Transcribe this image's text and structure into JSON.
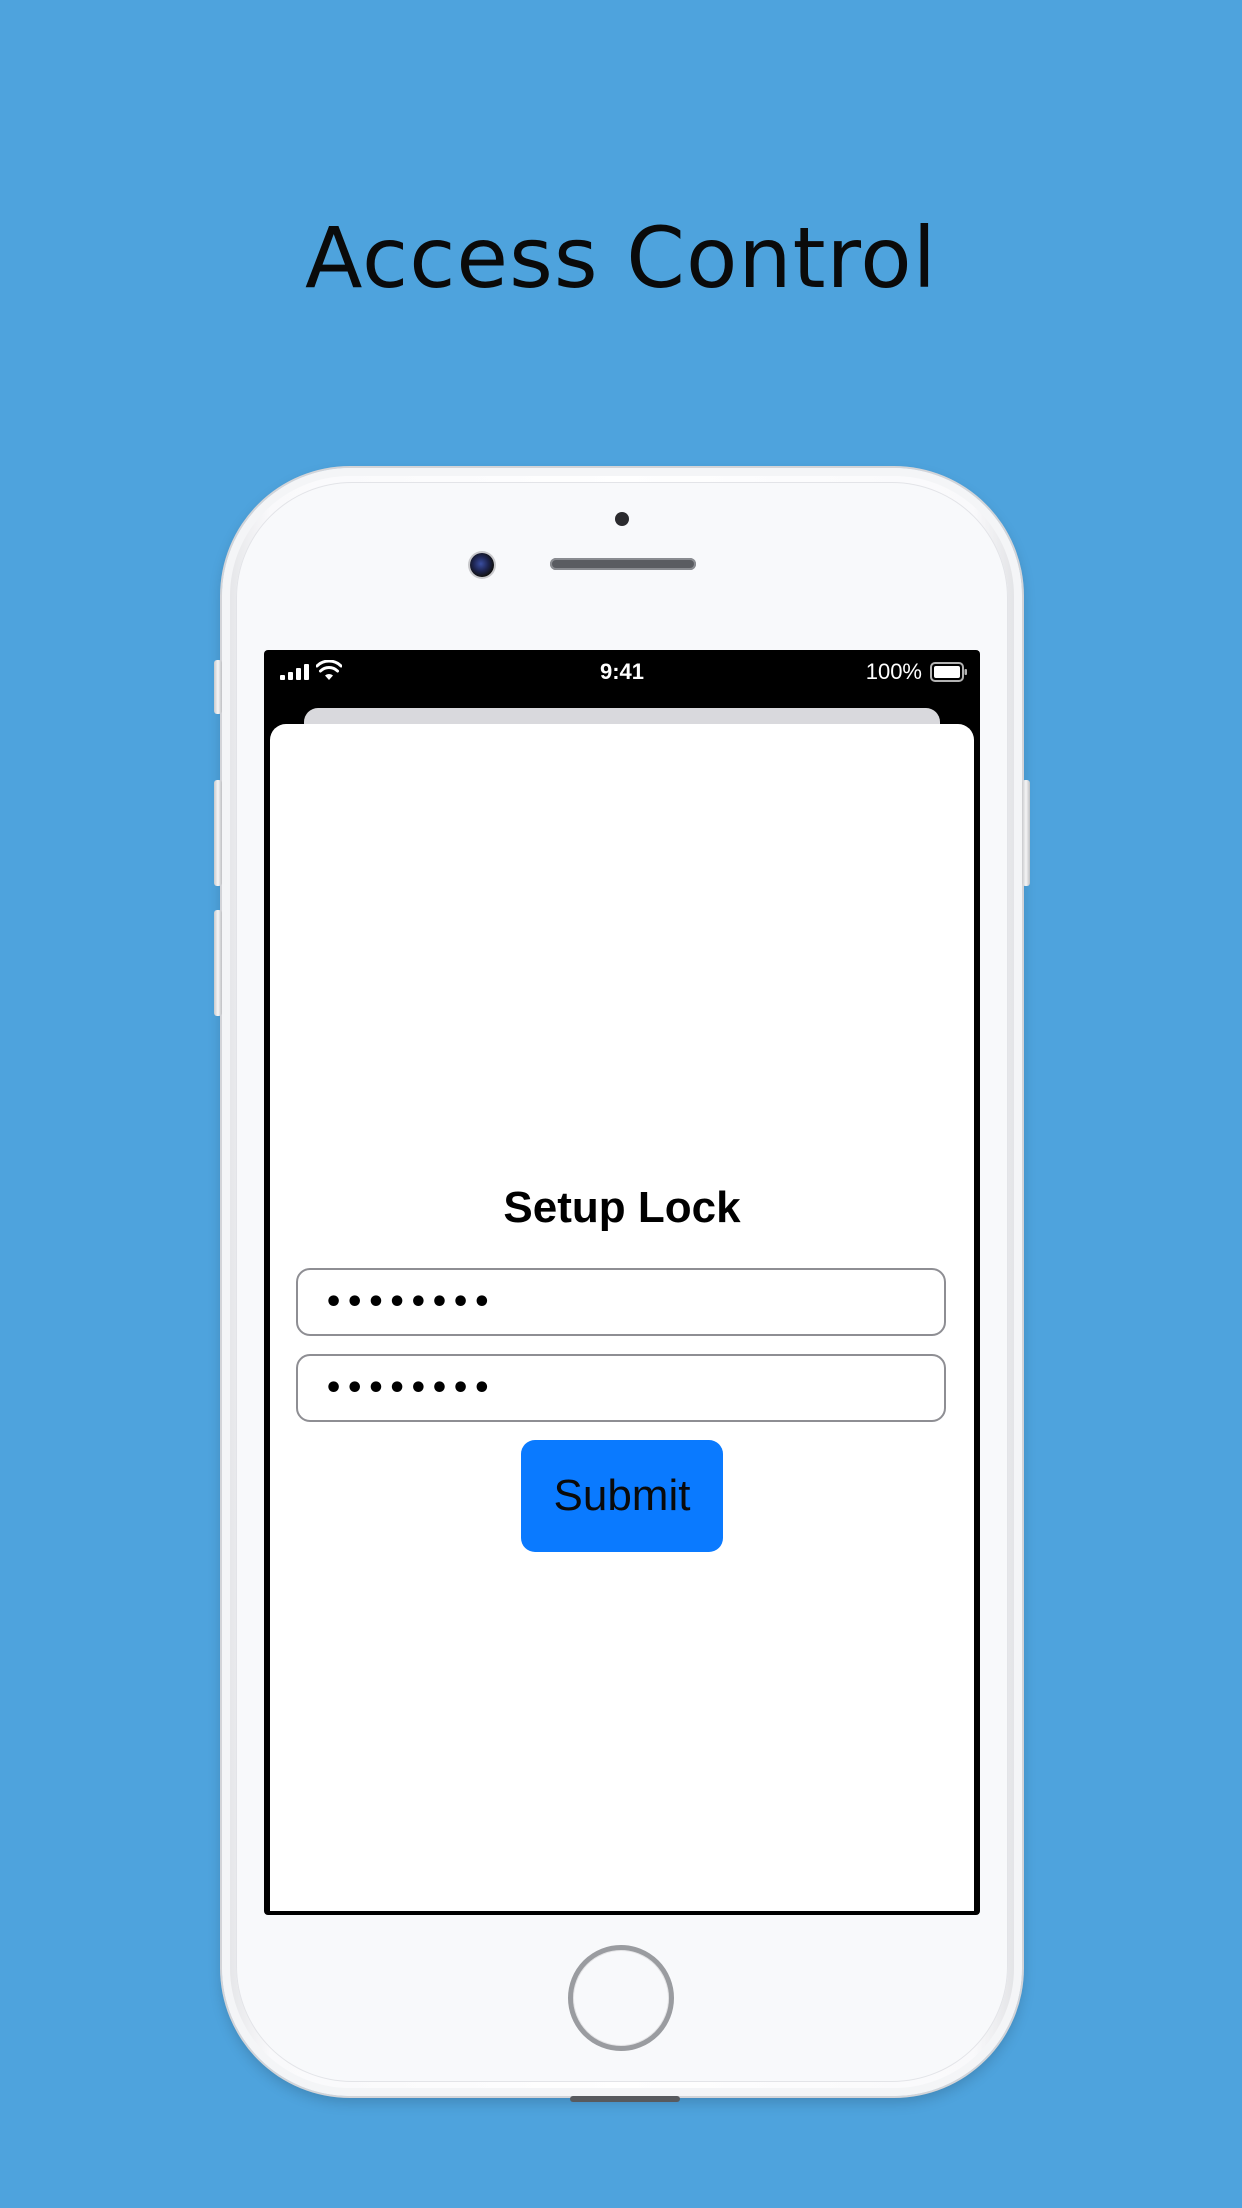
{
  "headline": "Access Control",
  "colors": {
    "background": "#4ea3dd",
    "accent": "#0a7aff"
  },
  "status_bar": {
    "time": "9:41",
    "battery_percent": "100%",
    "icons": [
      "cellular-signal-icon",
      "wifi-icon",
      "battery-icon"
    ]
  },
  "setup": {
    "title": "Setup Lock",
    "password_value": "••••••••",
    "confirm_value": "••••••••",
    "submit_label": "Submit"
  }
}
